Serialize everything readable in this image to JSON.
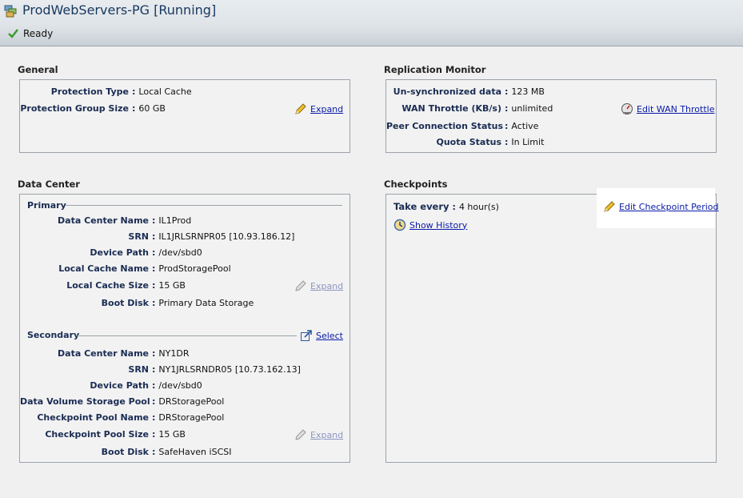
{
  "window": {
    "title": "ProdWebServers-PG [Running]",
    "status": "Ready"
  },
  "general": {
    "title": "General",
    "rows": [
      {
        "label": "Protection Type",
        "value": "Local Cache"
      },
      {
        "label": "Protection Group Size",
        "value": "60 GB"
      }
    ],
    "expand_label": "Expand"
  },
  "replication": {
    "title": "Replication Monitor",
    "rows": [
      {
        "label": "Un-synchronized data",
        "value": "123 MB"
      },
      {
        "label": "WAN Throttle (KB/s)",
        "value": "unlimited"
      },
      {
        "label": "Peer Connection Status",
        "value": "Active"
      },
      {
        "label": "Quota Status",
        "value": "In Limit"
      }
    ],
    "edit_label": "Edit WAN Throttle"
  },
  "datacenter": {
    "title": "Data Center",
    "primary": {
      "heading": "Primary",
      "rows": [
        {
          "label": "Data Center Name",
          "value": "IL1Prod"
        },
        {
          "label": "SRN",
          "value": "IL1JRLSRNPR05 [10.93.186.12]"
        },
        {
          "label": "Device Path",
          "value": "/dev/sbd0"
        },
        {
          "label": "Local Cache Name",
          "value": "ProdStoragePool"
        },
        {
          "label": "Local Cache Size",
          "value": "15 GB"
        },
        {
          "label": "Boot Disk",
          "value": "Primary Data Storage"
        }
      ],
      "expand_label": "Expand"
    },
    "secondary": {
      "heading": "Secondary",
      "select_label": "Select",
      "rows": [
        {
          "label": "Data Center Name",
          "value": "NY1DR"
        },
        {
          "label": "SRN",
          "value": "NY1JRLSRNDR05 [10.73.162.13]"
        },
        {
          "label": "Device Path",
          "value": "/dev/sbd0"
        },
        {
          "label": "Data Volume Storage Pool",
          "value": "DRStoragePool"
        },
        {
          "label": "Checkpoint Pool Name",
          "value": "DRStoragePool"
        },
        {
          "label": "Checkpoint Pool Size",
          "value": "15 GB"
        },
        {
          "label": "Boot Disk",
          "value": "SafeHaven iSCSI"
        }
      ],
      "expand_label": "Expand"
    }
  },
  "checkpoints": {
    "title": "Checkpoints",
    "take_every_label": "Take every",
    "take_every_value": "4 hour(s)",
    "show_history_label": "Show History",
    "edit_label": "Edit Checkpoint Period"
  },
  "colors": {
    "link": "#0a1aa8",
    "label": "#1a2c53",
    "title": "#17375e"
  },
  "icons": [
    "servers-icon",
    "checkmark-icon",
    "pencil-icon",
    "speedometer-icon",
    "select-arrow-icon",
    "clock-icon"
  ]
}
